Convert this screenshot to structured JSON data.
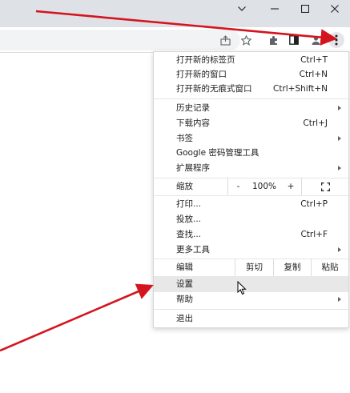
{
  "window_controls": {
    "chevron_icon": "chevron-down-icon",
    "minimize_icon": "minimize-icon",
    "maximize_icon": "maximize-icon",
    "close_icon": "close-icon"
  },
  "toolbar": {
    "share_icon": "share-icon",
    "bookmark_icon": "star-icon",
    "extensions_icon": "puzzle-icon",
    "sidepanel_icon": "side-panel-icon",
    "profile_icon": "profile-icon",
    "menu_icon": "more-vert-icon"
  },
  "menu": {
    "new_tab": {
      "label": "打开新的标签页",
      "shortcut": "Ctrl+T"
    },
    "new_window": {
      "label": "打开新的窗口",
      "shortcut": "Ctrl+N"
    },
    "new_incognito": {
      "label": "打开新的无痕式窗口",
      "shortcut": "Ctrl+Shift+N"
    },
    "history": {
      "label": "历史记录"
    },
    "downloads": {
      "label": "下载内容",
      "shortcut": "Ctrl+J"
    },
    "bookmarks": {
      "label": "书签"
    },
    "password_manager": {
      "label": "Google 密码管理工具"
    },
    "extensions": {
      "label": "扩展程序"
    },
    "zoom": {
      "label": "缩放",
      "minus": "-",
      "value": "100%",
      "plus": "+",
      "fullscreen_icon": "fullscreen-icon"
    },
    "print": {
      "label": "打印...",
      "shortcut": "Ctrl+P"
    },
    "cast": {
      "label": "投放..."
    },
    "find": {
      "label": "查找...",
      "shortcut": "Ctrl+F"
    },
    "more_tools": {
      "label": "更多工具"
    },
    "edit": {
      "label": "编辑",
      "cut": "剪切",
      "copy": "复制",
      "paste": "粘贴"
    },
    "settings": {
      "label": "设置"
    },
    "help": {
      "label": "帮助"
    },
    "exit": {
      "label": "退出"
    }
  },
  "annotations": {
    "arrow_color": "#d4141e"
  }
}
